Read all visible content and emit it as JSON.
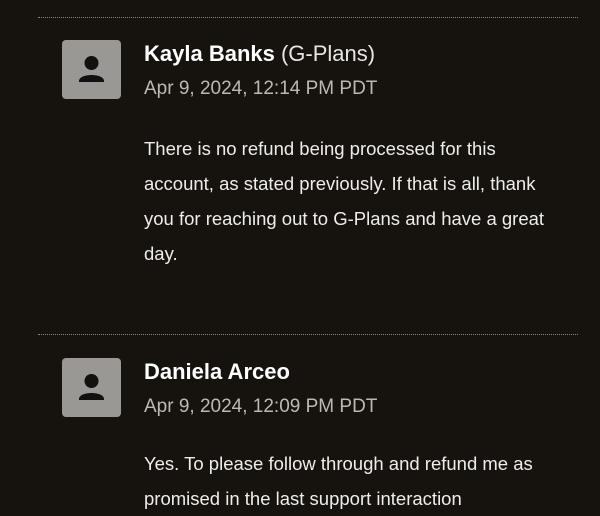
{
  "messages": [
    {
      "author_name": "Kayla Banks",
      "author_org": "(G-Plans)",
      "timestamp": "Apr 9, 2024, 12:14 PM PDT",
      "body": "There is no refund being processed for this account, as stated previously. If that is all, thank you for reaching out to G-Plans and have a great day."
    },
    {
      "author_name": "Daniela Arceo",
      "author_org": "",
      "timestamp": "Apr 9, 2024, 12:09 PM PDT",
      "body": "Yes. To please follow through and refund me as promised in the last support interaction"
    }
  ],
  "colors": {
    "background": "#16130f",
    "avatar": "#9a9895",
    "timestamp": "#bdb9b2"
  },
  "icons": {
    "avatar": "user-silhouette-icon"
  }
}
